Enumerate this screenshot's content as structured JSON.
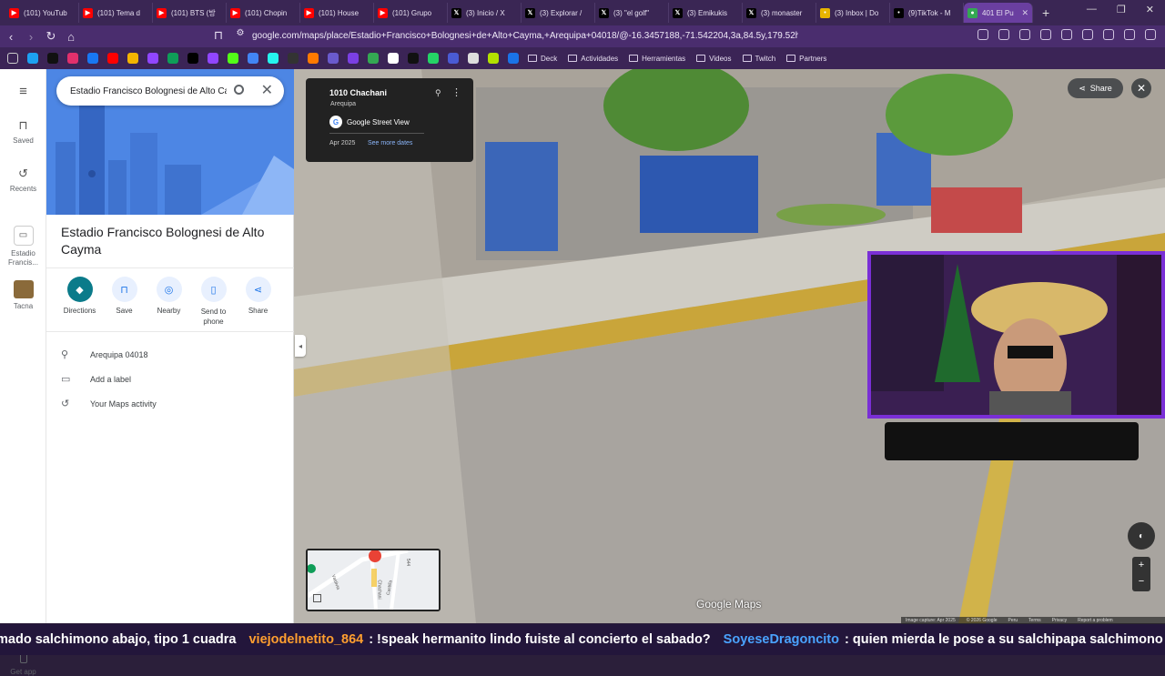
{
  "tabs": [
    {
      "label": "(101) YouTub",
      "icon": "youtube-icon",
      "color": "#ff0000"
    },
    {
      "label": "(101) Tema d",
      "icon": "youtube-icon",
      "color": "#ff0000"
    },
    {
      "label": "(101) BTS (방",
      "icon": "youtube-icon",
      "color": "#ff0000"
    },
    {
      "label": "(101) Chopin",
      "icon": "youtube-icon",
      "color": "#ff0000"
    },
    {
      "label": "(101) House",
      "icon": "youtube-icon",
      "color": "#ff0000"
    },
    {
      "label": "(101) Grupo",
      "icon": "youtube-icon",
      "color": "#ff0000"
    },
    {
      "label": "(3) Inicio / X",
      "icon": "x-icon",
      "color": "#000000"
    },
    {
      "label": "(3) Explorar /",
      "icon": "x-icon",
      "color": "#000000"
    },
    {
      "label": "(3) \"el golf\"",
      "icon": "x-icon",
      "color": "#000000"
    },
    {
      "label": "(3) Emikukis",
      "icon": "x-icon",
      "color": "#000000"
    },
    {
      "label": "(3) monaster",
      "icon": "x-icon",
      "color": "#000000"
    },
    {
      "label": "(3) Inbox | Do",
      "icon": "inbox-icon",
      "color": "#e8b400"
    },
    {
      "label": "(9)TikTok - M",
      "icon": "tiktok-icon",
      "color": "#000000"
    }
  ],
  "active_tab": {
    "label": "401 El Pu",
    "icon": "maps-icon",
    "color": "#34a853"
  },
  "address_bar": {
    "url": "google.com/maps/place/Estadio+Francisco+Bolognesi+de+Alto+Cayma,+Arequipa+04018/@-16.3457188,-71.542204,3a,84.5y,179.52h,57.72t/..."
  },
  "bookmarks": {
    "folders": [
      "Deck",
      "Actividades",
      "Herramientas",
      "Videos",
      "Twitch",
      "Partners"
    ]
  },
  "rail": {
    "items": [
      {
        "label": "Saved",
        "icon": "bookmark-icon"
      },
      {
        "label": "Recents",
        "icon": "history-icon"
      },
      {
        "label": "Estadio Francis...",
        "icon": "stadium-icon"
      },
      {
        "label": "Tacna",
        "icon": "place-thumbnail-icon"
      }
    ],
    "get_app": "Get app"
  },
  "search": {
    "value": "Estadio Francisco Bolognesi de Alto Cayma"
  },
  "place": {
    "title": "Estadio Francisco Bolognesi de Alto Cayma",
    "actions": [
      {
        "label": "Directions",
        "icon": "directions-icon"
      },
      {
        "label": "Save",
        "icon": "bookmark-icon"
      },
      {
        "label": "Nearby",
        "icon": "nearby-icon"
      },
      {
        "label": "Send to phone",
        "icon": "phone-icon"
      },
      {
        "label": "Share",
        "icon": "share-icon"
      }
    ],
    "info": [
      {
        "text": "Arequipa 04018",
        "icon": "location-pin-icon"
      },
      {
        "text": "Add a label",
        "icon": "label-icon"
      },
      {
        "text": "Your Maps activity",
        "icon": "history-icon"
      }
    ]
  },
  "streetview": {
    "address": "1010 Chachani",
    "city": "Arequipa",
    "source": "Google Street View",
    "date": "Apr 2025",
    "see_more": "See more dates",
    "share_label": "Share",
    "logo": "Google Maps",
    "footer": [
      "Image capture: Apr 2025",
      "© 2026 Google",
      "Peru",
      "Terms",
      "Privacy",
      "Report a problem"
    ]
  },
  "minimap": {
    "street_labels": [
      "Chachani",
      "Castilla",
      "Valdivia",
      "544"
    ]
  },
  "ticker": {
    "lead": "mado salchimono abajo, tipo 1 cuadra",
    "messages": [
      {
        "user": "viejodelnetito_864",
        "text": ": !speak hermanito lindo fuiste al concierto el sabado?"
      },
      {
        "user": "SoyeseDragoncito",
        "text": ": quien mierda le pose a su salchipapa salchimono"
      }
    ]
  },
  "colors": {
    "brand_purple": "#7a2fd6",
    "accent_blue": "#1a73e8",
    "user1": "#ff9f2f",
    "user2": "#4aa3ff"
  }
}
